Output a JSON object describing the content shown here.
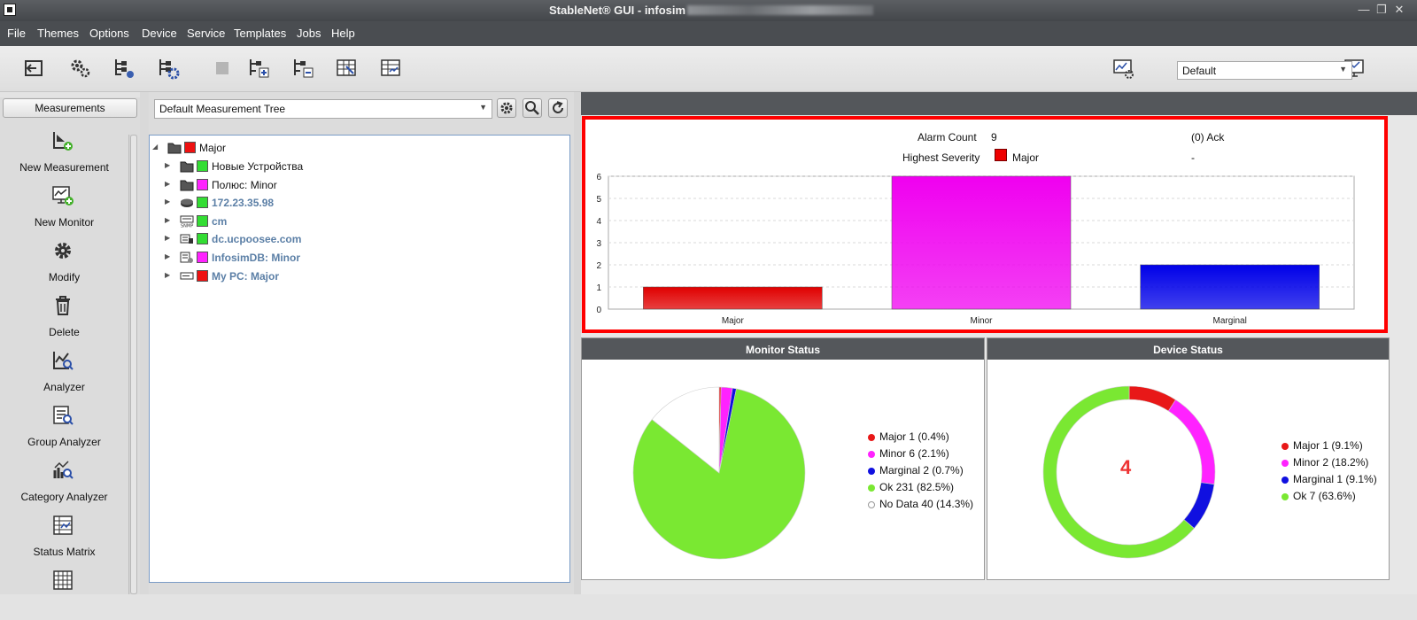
{
  "window": {
    "title": "StableNet® GUI - infosim"
  },
  "menu": [
    "File",
    "Themes",
    "Options",
    "Device",
    "Service",
    "Templates",
    "Jobs",
    "Help"
  ],
  "toolbar": {
    "left_icons": [
      "logout-icon",
      "settings-gears-icon",
      "tree-settings-icon",
      "tree-settings-blue-icon",
      "stop-icon",
      "tree-add-icon",
      "tree-remove-icon",
      "table-edit-icon",
      "table-view-icon"
    ],
    "view_selector_value": "Default"
  },
  "sidebar": {
    "header": "Measurements",
    "items": [
      {
        "label": "New Measurement",
        "icon": "new-measurement-icon"
      },
      {
        "label": "New Monitor",
        "icon": "new-monitor-icon"
      },
      {
        "label": "Modify",
        "icon": "gear-icon"
      },
      {
        "label": "Delete",
        "icon": "trash-icon"
      },
      {
        "label": "Analyzer",
        "icon": "analyzer-icon"
      },
      {
        "label": "Group Analyzer",
        "icon": "group-analyzer-icon"
      },
      {
        "label": "Category Analyzer",
        "icon": "category-analyzer-icon"
      },
      {
        "label": "Status Matrix",
        "icon": "status-matrix-icon"
      },
      {
        "label": "",
        "icon": "grid-icon"
      }
    ]
  },
  "tree": {
    "selector_value": "Default Measurement Tree",
    "root": {
      "label": "Major",
      "color": "#ee1111"
    },
    "children": [
      {
        "label": "Новые Устройства",
        "color": "#33dd33",
        "style": "normal",
        "icon": "folder-icon"
      },
      {
        "label": "Полюс: Minor",
        "color": "#ff22ff",
        "style": "normal",
        "icon": "folder-icon"
      },
      {
        "label": "172.23.35.98",
        "color": "#33dd33",
        "style": "link",
        "icon": "router-icon"
      },
      {
        "label": "cm",
        "color": "#33dd33",
        "style": "link",
        "icon": "snmp-device-icon"
      },
      {
        "label": "dc.ucpoosee.com",
        "color": "#33dd33",
        "style": "link",
        "icon": "windows-server-icon"
      },
      {
        "label": "InfosimDB: Minor",
        "color": "#ff22ff",
        "style": "link",
        "icon": "linux-server-icon"
      },
      {
        "label": "My PC: Major",
        "color": "#ee1111",
        "style": "link",
        "icon": "server-icon"
      }
    ]
  },
  "alarm": {
    "count_label": "Alarm Count",
    "count_value": "9",
    "ack": "(0) Ack",
    "severity_label": "Highest Severity",
    "severity_value": "Major",
    "severity_extra": "-"
  },
  "chart_data": [
    {
      "type": "bar",
      "categories": [
        "Major",
        "Minor",
        "Marginal"
      ],
      "values": [
        1,
        6,
        2
      ],
      "colors": [
        "#e00000",
        "#f000f0",
        "#0000e8"
      ],
      "ylim": [
        0,
        6
      ],
      "yticks": [
        0,
        1,
        2,
        3,
        4,
        5,
        6
      ],
      "grid": true
    },
    {
      "type": "pie",
      "title": "Monitor Status",
      "labels": [
        "Major",
        "Minor",
        "Marginal",
        "Ok",
        "No Data"
      ],
      "values": [
        1,
        6,
        2,
        231,
        40
      ],
      "legend": [
        "Major 1 (0.4%)",
        "Minor 6 (2.1%)",
        "Marginal 2 (0.7%)",
        "Ok 231 (82.5%)",
        "No Data 40 (14.3%)"
      ],
      "colors": [
        "#e81818",
        "#ff22ff",
        "#1010e0",
        "#7ae832",
        "#ffffff"
      ],
      "legend_position": "right"
    },
    {
      "type": "pie",
      "title": "Device Status",
      "center_label": "4",
      "labels": [
        "Major",
        "Minor",
        "Marginal",
        "Ok"
      ],
      "values": [
        1,
        2,
        1,
        7
      ],
      "legend": [
        "Major 1 (9.1%)",
        "Minor 2 (18.2%)",
        "Marginal 1 (9.1%)",
        "Ok 7 (63.6%)"
      ],
      "colors": [
        "#e81818",
        "#ff22ff",
        "#1010e0",
        "#7ae832"
      ],
      "legend_position": "right"
    }
  ]
}
